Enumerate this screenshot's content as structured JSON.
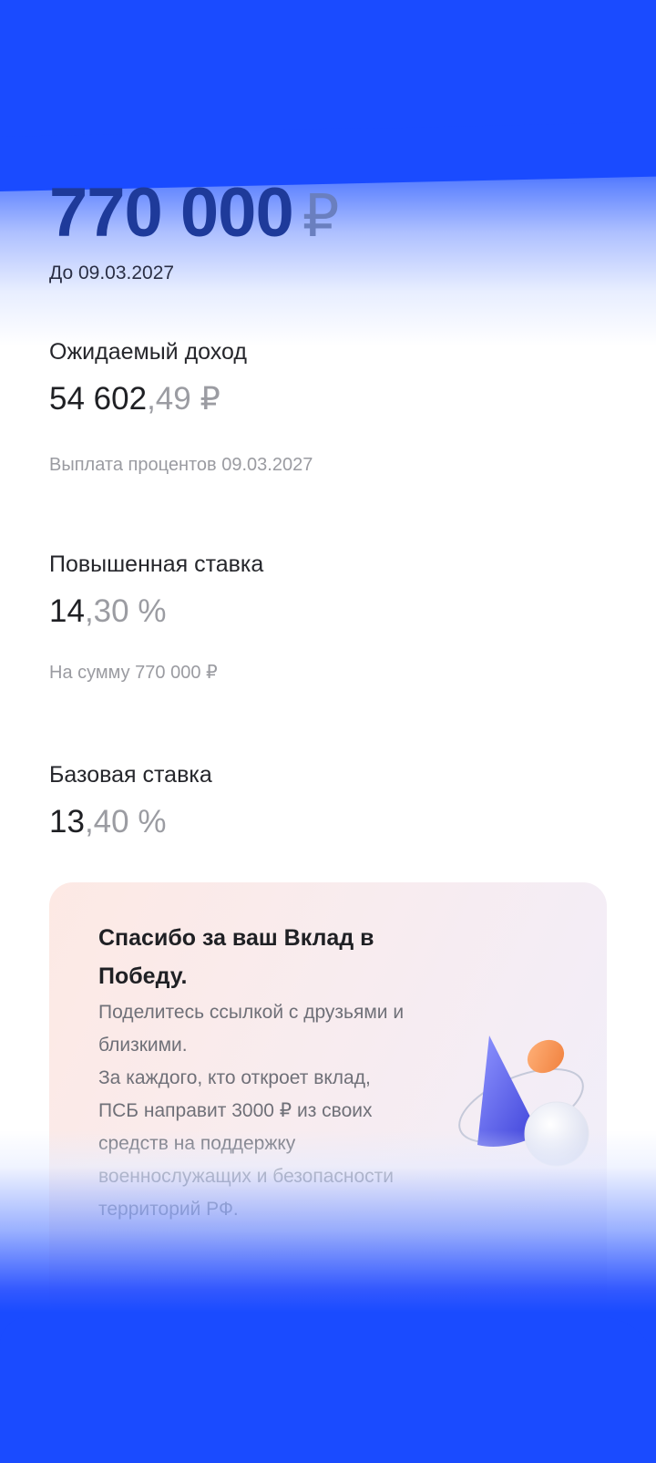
{
  "deposit": {
    "amount": "770 000",
    "currency": "₽",
    "until": "До 09.03.2027"
  },
  "income": {
    "label": "Ожидаемый доход",
    "whole": "54 602",
    "fraction": ",49 ₽",
    "note": "Выплата процентов 09.03.2027"
  },
  "bonus_rate": {
    "label": "Повышенная ставка",
    "whole": "14",
    "fraction": ",30 %",
    "note": "На сумму 770 000 ₽"
  },
  "base_rate": {
    "label": "Базовая ставка",
    "whole": "13",
    "fraction": ",40 %"
  },
  "promo": {
    "title": "Спасибо за ваш Вклад в Победу.",
    "text": "Поделитесь ссылкой с друзьями и близкими.\nЗа каждого, кто откроет вклад, ПСБ направит 3000 ₽ из своих средств на поддержку военнослужащих и безопасности территорий РФ.",
    "illustration": "cone-sphere-coin-illustration"
  },
  "colors": {
    "brand_blue": "#1a4bff",
    "amount_text": "#1e3a9a"
  }
}
